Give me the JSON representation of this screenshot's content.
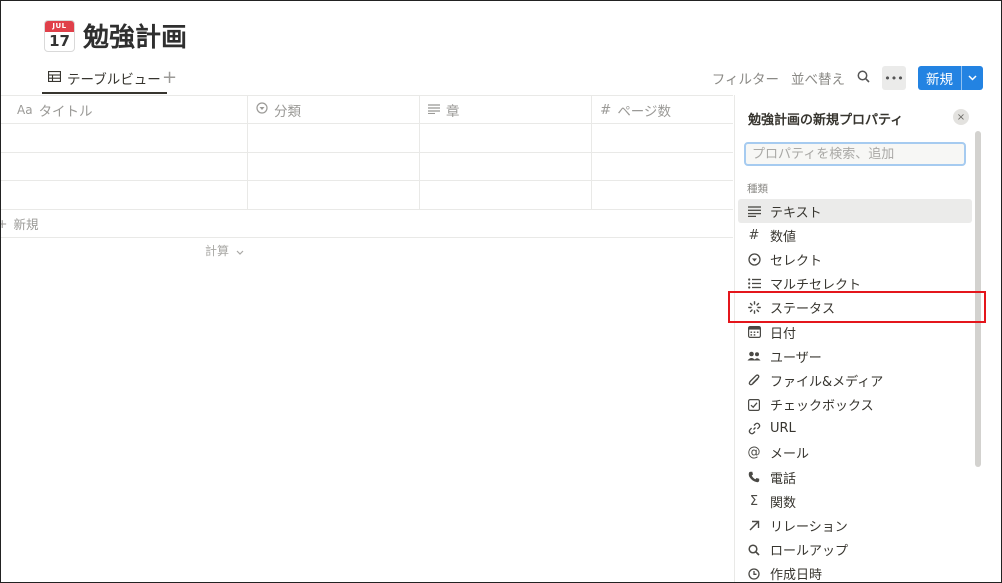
{
  "page": {
    "icon": {
      "name": "calendar-icon",
      "month": "JUL",
      "day": "17"
    },
    "title": "勉強計画"
  },
  "view_bar": {
    "active_tab_label": "テーブルビュー",
    "add_view": "+",
    "filter": "フィルター",
    "sort": "並べ替え",
    "more": "•••",
    "new_button": "新規",
    "new_dropdown": "⌄"
  },
  "table": {
    "columns": [
      {
        "icon": "Aa",
        "label": "タイトル"
      },
      {
        "icon": "select-icon",
        "label": "分類"
      },
      {
        "icon": "text-icon",
        "label": "章"
      },
      {
        "icon": "#",
        "label": "ページ数"
      }
    ],
    "rows": [
      [
        "",
        "",
        "",
        ""
      ],
      [
        "",
        "",
        "",
        ""
      ],
      [
        "",
        "",
        "",
        ""
      ]
    ],
    "new_row_plus": "+",
    "new_row_label": "新規",
    "calculate_label": "計算"
  },
  "panel": {
    "title": "勉強計画の新規プロパティ",
    "close": "×",
    "search_placeholder": "プロパティを検索、追加",
    "section_label": "種類",
    "types": [
      {
        "icon": "text-icon",
        "label": "テキスト"
      },
      {
        "icon": "number-icon",
        "label": "数値"
      },
      {
        "icon": "select-icon",
        "label": "セレクト"
      },
      {
        "icon": "multi-select-icon",
        "label": "マルチセレクト"
      },
      {
        "icon": "status-icon",
        "label": "ステータス"
      },
      {
        "icon": "date-icon",
        "label": "日付"
      },
      {
        "icon": "person-icon",
        "label": "ユーザー"
      },
      {
        "icon": "paperclip-icon",
        "label": "ファイル&メディア"
      },
      {
        "icon": "checkbox-icon",
        "label": "チェックボックス"
      },
      {
        "icon": "link-icon",
        "label": "URL"
      },
      {
        "icon": "at-icon",
        "label": "メール"
      },
      {
        "icon": "phone-icon",
        "label": "電話"
      },
      {
        "icon": "sigma-icon",
        "label": "関数"
      },
      {
        "icon": "arrow-up-right-icon",
        "label": "リレーション"
      },
      {
        "icon": "search-icon",
        "label": "ロールアップ"
      },
      {
        "icon": "clock-icon",
        "label": "作成日時"
      }
    ]
  },
  "colors": {
    "accent": "#2383e2",
    "highlight": "#e4161c",
    "calendar_red": "#e0404a"
  }
}
